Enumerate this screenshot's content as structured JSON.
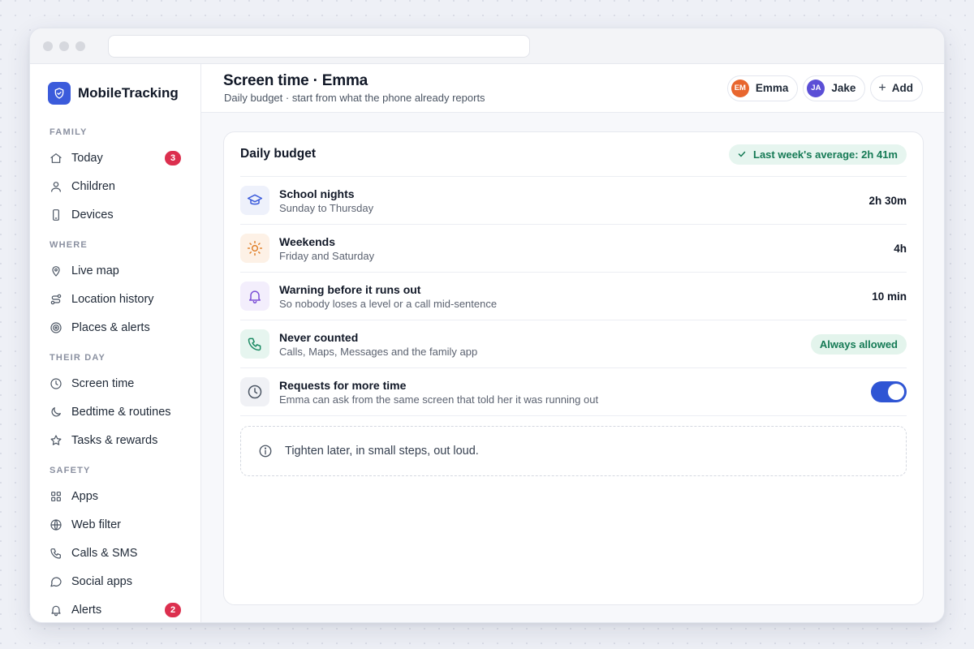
{
  "window": {
    "url": ""
  },
  "brand": {
    "name": "MobileTracking",
    "logo_icon": "shield-check-icon"
  },
  "sidebar": {
    "sections": [
      {
        "label": "FAMILY",
        "items": [
          {
            "label": "Today",
            "icon": "home-icon",
            "badge": "3"
          },
          {
            "label": "Children",
            "icon": "user-icon"
          },
          {
            "label": "Devices",
            "icon": "phone-icon"
          }
        ]
      },
      {
        "label": "WHERE",
        "items": [
          {
            "label": "Live map",
            "icon": "map-pin-icon"
          },
          {
            "label": "Location history",
            "icon": "route-icon"
          },
          {
            "label": "Places & alerts",
            "icon": "target-icon"
          }
        ]
      },
      {
        "label": "THEIR DAY",
        "items": [
          {
            "label": "Screen time",
            "icon": "clock-icon"
          },
          {
            "label": "Bedtime & routines",
            "icon": "moon-icon"
          },
          {
            "label": "Tasks & rewards",
            "icon": "star-icon"
          }
        ]
      },
      {
        "label": "SAFETY",
        "items": [
          {
            "label": "Apps",
            "icon": "grid-icon"
          },
          {
            "label": "Web filter",
            "icon": "globe-icon"
          },
          {
            "label": "Calls & SMS",
            "icon": "phone-call-icon"
          },
          {
            "label": "Social apps",
            "icon": "chat-bubble-icon"
          },
          {
            "label": "Alerts",
            "icon": "bell-icon",
            "badge": "2"
          }
        ]
      }
    ]
  },
  "header": {
    "title": "Screen time · Emma",
    "subtitle": "Daily budget · start from what the phone already reports",
    "children": [
      {
        "initials": "EM",
        "name": "Emma",
        "color": "#e8662e"
      },
      {
        "initials": "JA",
        "name": "Jake",
        "color": "#5b4fd6"
      }
    ],
    "add_label": "Add"
  },
  "card": {
    "title": "Daily budget",
    "average_label": "Last week's average: 2h 41m",
    "rows": [
      {
        "title": "School nights",
        "subtitle": "Sunday to Thursday",
        "value": "2h 30m",
        "icon": "graduation-cap-icon",
        "icon_bg": "#eef1fb",
        "icon_color": "#3b5bdb"
      },
      {
        "title": "Weekends",
        "subtitle": "Friday and Saturday",
        "value": "4h",
        "icon": "sun-icon",
        "icon_bg": "#fdf1e6",
        "icon_color": "#e0802a"
      },
      {
        "title": "Warning before it runs out",
        "subtitle": "So nobody loses a level or a call mid-sentence",
        "value": "10 min",
        "icon": "bell-icon",
        "icon_bg": "#f3eefc",
        "icon_color": "#7c4fd6"
      },
      {
        "title": "Never counted",
        "subtitle": "Calls, Maps, Messages and the family app",
        "value": "Always allowed",
        "icon": "phone-call-icon",
        "icon_bg": "#e6f5ef",
        "icon_color": "#1b8a63"
      },
      {
        "title": "Requests for more time",
        "subtitle": "Emma can ask from the same screen that told her it was running out",
        "toggle_on": true,
        "icon": "clock-icon",
        "icon_bg": "#f0f1f5",
        "icon_color": "#4b5563"
      }
    ],
    "note": "Tighten later, in small steps, out loud."
  },
  "colors": {
    "accent": "#3b5bdb",
    "badge": "#dc2f4e",
    "success": "#157a55"
  }
}
